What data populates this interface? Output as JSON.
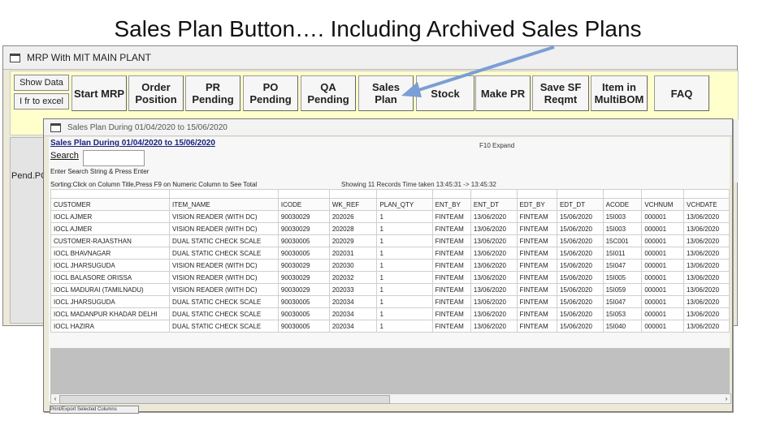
{
  "slide": {
    "title": "Sales Plan Button…. Including Archived Sales Plans"
  },
  "outer_window": {
    "title": "MRP With MIT MAIN PLANT",
    "side_buttons": [
      "Show Data",
      "I fr to excel"
    ],
    "toolbar": [
      {
        "label": "Start MRP"
      },
      {
        "label": "Order\nPosition"
      },
      {
        "label": "PR\nPending"
      },
      {
        "label": "PO\nPending"
      },
      {
        "label": "QA\nPending"
      },
      {
        "label": "Sales\nPlan"
      },
      {
        "label": "Stock"
      },
      {
        "label": "Make PR"
      },
      {
        "label": "Save SF\nReqmt"
      },
      {
        "label": "Item in\nMultiBOM"
      },
      {
        "label": "FAQ"
      }
    ],
    "left_label": "Pend.PO"
  },
  "inner_window": {
    "title": "Sales Plan During 01/04/2020 to 15/06/2020",
    "list_header": "Sales Plan During 01/04/2020 to 15/06/2020",
    "f10_label": "F10  Expand",
    "search_label": "Search",
    "search_value": "",
    "hint1": "Enter Search String & Press Enter",
    "hint2": "Sorting:Click on Column Title,Press F9 on Numeric Column to See Total",
    "showing": "Showing 11 Records  Time taken 13:45:31 -> 13:45:32",
    "bottom_button": "Print/Export Selected Columns"
  },
  "table": {
    "columns": [
      "CUSTOMER",
      "ITEM_NAME",
      "ICODE",
      "WK_REF",
      "PLAN_QTY",
      "ENT_BY",
      "ENT_DT",
      "EDT_BY",
      "EDT_DT",
      "ACODE",
      "VCHNUM",
      "VCHDATE"
    ],
    "rows": [
      [
        "IOCL AJMER",
        "VISION READER (WITH DC)",
        "90030029",
        "202026",
        "1",
        "FINTEAM",
        "13/06/2020",
        "FINTEAM",
        "15/06/2020",
        "15I003",
        "000001",
        "13/06/2020"
      ],
      [
        "IOCL AJMER",
        "VISION READER (WITH DC)",
        "90030029",
        "202028",
        "1",
        "FINTEAM",
        "13/06/2020",
        "FINTEAM",
        "15/06/2020",
        "15I003",
        "000001",
        "13/06/2020"
      ],
      [
        "CUSTOMER-RAJASTHAN",
        "DUAL STATIC CHECK SCALE",
        "90030005",
        "202029",
        "1",
        "FINTEAM",
        "13/06/2020",
        "FINTEAM",
        "15/06/2020",
        "15C001",
        "000001",
        "13/06/2020"
      ],
      [
        "IOCL BHAVNAGAR",
        "DUAL STATIC CHECK SCALE",
        "90030005",
        "202031",
        "1",
        "FINTEAM",
        "13/06/2020",
        "FINTEAM",
        "15/06/2020",
        "15I011",
        "000001",
        "13/06/2020"
      ],
      [
        "IOCL JHARSUGUDA",
        "VISION READER (WITH DC)",
        "90030029",
        "202030",
        "1",
        "FINTEAM",
        "13/06/2020",
        "FINTEAM",
        "15/06/2020",
        "15I047",
        "000001",
        "13/06/2020"
      ],
      [
        "IOCL BALASORE ORISSA",
        "VISION READER (WITH DC)",
        "90030029",
        "202032",
        "1",
        "FINTEAM",
        "13/06/2020",
        "FINTEAM",
        "15/06/2020",
        "15I005",
        "000001",
        "13/06/2020"
      ],
      [
        "IOCL MADURAI (TAMILNADU)",
        "VISION READER (WITH DC)",
        "90030029",
        "202033",
        "1",
        "FINTEAM",
        "13/06/2020",
        "FINTEAM",
        "15/06/2020",
        "15I059",
        "000001",
        "13/06/2020"
      ],
      [
        "IOCL JHARSUGUDA",
        "DUAL STATIC CHECK SCALE",
        "90030005",
        "202034",
        "1",
        "FINTEAM",
        "13/06/2020",
        "FINTEAM",
        "15/06/2020",
        "15I047",
        "000001",
        "13/06/2020"
      ],
      [
        "IOCL MADANPUR KHADAR DELHI",
        "DUAL STATIC CHECK SCALE",
        "90030005",
        "202034",
        "1",
        "FINTEAM",
        "13/06/2020",
        "FINTEAM",
        "15/06/2020",
        "15I053",
        "000001",
        "13/06/2020"
      ],
      [
        "IOCL HAZIRA",
        "DUAL STATIC CHECK SCALE",
        "90030005",
        "202034",
        "1",
        "FINTEAM",
        "13/06/2020",
        "FINTEAM",
        "15/06/2020",
        "15I040",
        "000001",
        "13/06/2020"
      ]
    ]
  },
  "colors": {
    "ribbon": "#ffffcc",
    "arrow": "#7a9fd4"
  }
}
